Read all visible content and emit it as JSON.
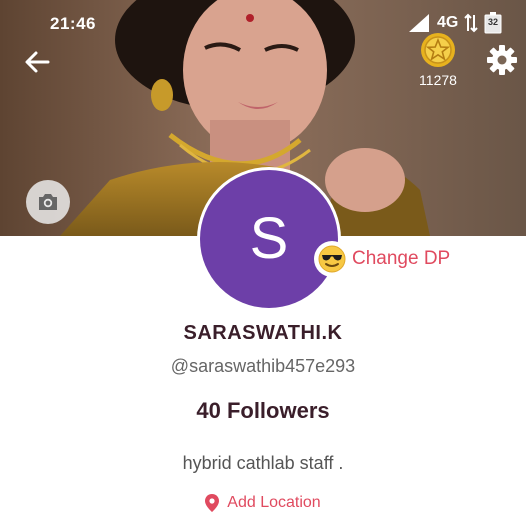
{
  "status_bar": {
    "time": "21:46",
    "network": "4G",
    "battery_level": "32"
  },
  "header": {
    "coins": "11278",
    "icons": {
      "back": "arrow-left-icon",
      "coin": "star-coin-icon",
      "settings": "gear-icon",
      "camera": "camera-icon"
    }
  },
  "profile": {
    "avatar_letter": "S",
    "change_dp_label": "Change DP",
    "name": "SARASWATHI.K",
    "handle": "@saraswathib457e293",
    "followers": "40 Followers",
    "bio": "hybrid cathlab staff .",
    "add_location_label": "Add Location"
  },
  "colors": {
    "avatar": "#6d3fa8",
    "accent": "#e04a5f",
    "name_text": "#3a1e2a"
  }
}
